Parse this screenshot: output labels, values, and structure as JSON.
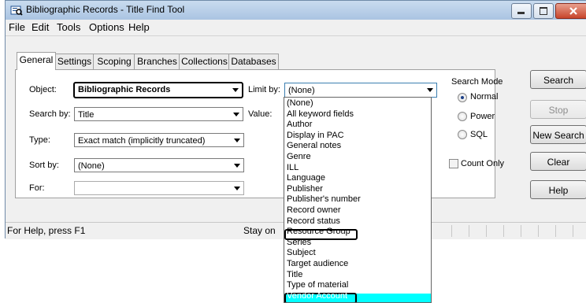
{
  "window": {
    "title": "Bibliographic Records - Title Find Tool"
  },
  "menu": [
    "File",
    "Edit",
    "Tools",
    "Options",
    "Help"
  ],
  "tabs": [
    "General",
    "Settings",
    "Scoping",
    "Branches",
    "Collections",
    "Databases"
  ],
  "form": {
    "object_label": "Object:",
    "object_value": "Bibliographic Records",
    "search_by_label": "Search by:",
    "search_by_value": "Title",
    "type_label": "Type:",
    "type_value": "Exact match (implicitly truncated)",
    "sort_by_label": "Sort by:",
    "sort_by_value": "(None)",
    "for_label": "For:",
    "for_value": "",
    "limit_by_label": "Limit by:",
    "limit_by_value": "(None)",
    "value_label": "Value:"
  },
  "search_mode": {
    "title": "Search Mode",
    "options": [
      "Normal",
      "Power",
      "SQL"
    ],
    "selected": "Normal"
  },
  "count_only_label": "Count Only",
  "buttons": {
    "search": "Search",
    "stop": "Stop",
    "new_search": "New Search",
    "clear": "Clear",
    "help": "Help"
  },
  "status": {
    "left": "For Help, press F1",
    "middle": "Stay on"
  },
  "limit_by_options": [
    "(None)",
    "All keyword fields",
    "Author",
    "Display in PAC",
    "General notes",
    "Genre",
    "ILL",
    "Language",
    "Publisher",
    "Publisher's number",
    "Record owner",
    "Record status",
    "Resource Group",
    "Series",
    "Subject",
    "Target audience",
    "Title",
    "Type of material",
    "Vendor Account"
  ],
  "colors": {
    "highlight": "#00ffff",
    "title_bar": "#bcd3ea",
    "selection": "#3399ff"
  }
}
